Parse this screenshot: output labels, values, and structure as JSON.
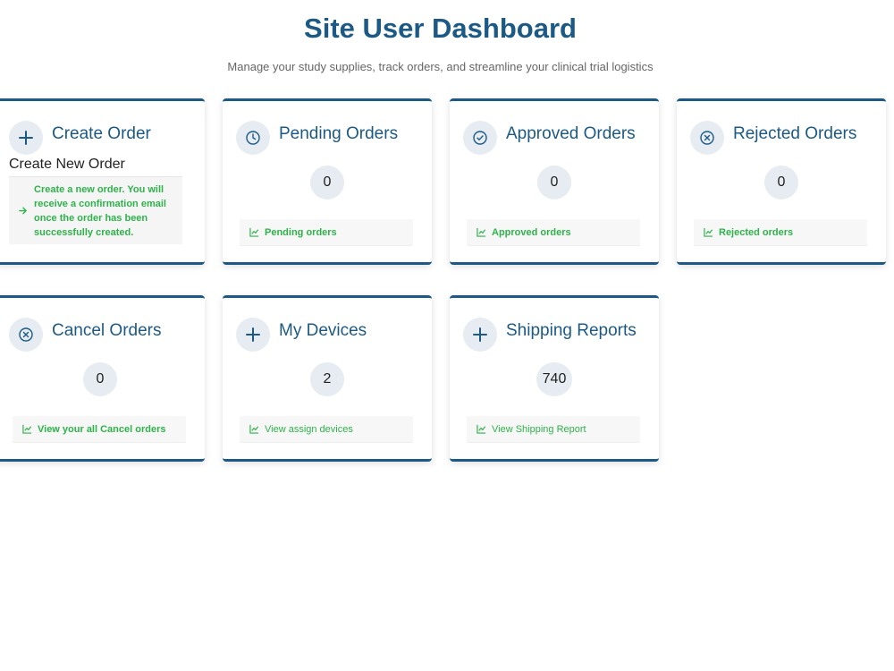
{
  "header": {
    "title": "Site User Dashboard",
    "subtitle": "Manage your study supplies, track orders, and streamline your clinical trial logistics"
  },
  "colors": {
    "primary": "#1c5a85",
    "accent_green": "#2db34a",
    "icon_bg": "#e6ecf1"
  },
  "cards": {
    "create_order": {
      "icon": "plus-icon",
      "title": "Create Order",
      "subtitle": "Create New Order",
      "description": "Create a new order. You will receive a confirmation email once the order has been successfully created.",
      "link_icon": "arrow-right-icon"
    },
    "pending_orders": {
      "icon": "clock-icon",
      "title": "Pending Orders",
      "count": "0",
      "link": "Pending orders"
    },
    "approved_orders": {
      "icon": "check-circle-icon",
      "title": "Approved Orders",
      "count": "0",
      "link": "Approved orders"
    },
    "rejected_orders": {
      "icon": "x-circle-icon",
      "title": "Rejected Orders",
      "count": "0",
      "link": "Rejected orders"
    },
    "cancel_orders": {
      "icon": "x-circle-icon",
      "title": "Cancel Orders",
      "count": "0",
      "link": "View your all Cancel orders"
    },
    "my_devices": {
      "icon": "plus-icon",
      "title": "My Devices",
      "count": "2",
      "link": "View assign devices"
    },
    "shipping_reports": {
      "icon": "plus-icon",
      "title": "Shipping Reports",
      "count": "740",
      "link": "View Shipping Report"
    }
  }
}
